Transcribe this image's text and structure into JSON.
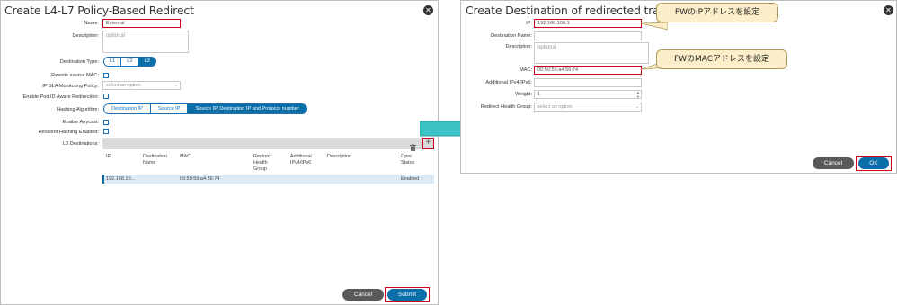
{
  "left_dialog": {
    "title": "Create L4-L7 Policy-Based Redirect",
    "fields": {
      "name_label": "Name:",
      "name_value": "External",
      "description_label": "Description:",
      "description_placeholder": "optional",
      "destination_type_label": "Destination Type:",
      "destination_type_options": [
        "L1",
        "L2",
        "L3"
      ],
      "destination_type_selected": "L3",
      "rewrite_mac_label": "Rewrite source MAC:",
      "ip_sla_label": "IP SLA Monitoring Policy:",
      "ip_sla_placeholder": "select an option",
      "pod_id_label": "Enable Pod ID Aware Redirection:",
      "hashing_label": "Hashing Algorithm:",
      "hashing_options": [
        "Destination IP",
        "Source IP",
        "Source IP, Destination IP and Protocol number"
      ],
      "hashing_selected": "Source IP, Destination IP and Protocol number",
      "anycast_label": "Enable Anycast:",
      "resilient_label": "Resilient Hashing Enabled:",
      "l3_dest_label": "L3 Destinations:"
    },
    "table": {
      "headers": [
        "IP",
        "Destination Name",
        "MAC",
        "Redirect Health Group",
        "Additional IPv4/IPv6",
        "Description",
        "Oper Status"
      ],
      "rows": [
        {
          "ip": "192.168.10...",
          "name": "",
          "mac": "00:50:56:a4:56:74",
          "health": "",
          "additional": "",
          "description": "",
          "status": "Enabled"
        }
      ]
    },
    "buttons": {
      "cancel": "Cancel",
      "submit": "Submit"
    }
  },
  "right_dialog": {
    "title": "Create Destination of redirected traffic",
    "fields": {
      "ip_label": "IP:",
      "ip_value": "192.168.100.1",
      "dest_name_label": "Destination Name:",
      "description_label": "Description:",
      "description_placeholder": "optional",
      "mac_label": "MAC:",
      "mac_value": "00:50:56:a4:56:74",
      "additional_label": "Additional IPv4/IPv6:",
      "weight_label": "Weight:",
      "weight_value": "1",
      "health_group_label": "Redirect Health Group:",
      "health_group_placeholder": "select an option"
    },
    "buttons": {
      "cancel": "Cancel",
      "ok": "OK"
    }
  },
  "callouts": {
    "ip": "FWのIPアドレスを設定",
    "mac": "FWのMACアドレスを設定"
  },
  "colors": {
    "accent": "#0a6ea8",
    "highlight": "#d0021b",
    "arrow": "#3cc3c3",
    "callout_bg": "#fbeec9"
  }
}
